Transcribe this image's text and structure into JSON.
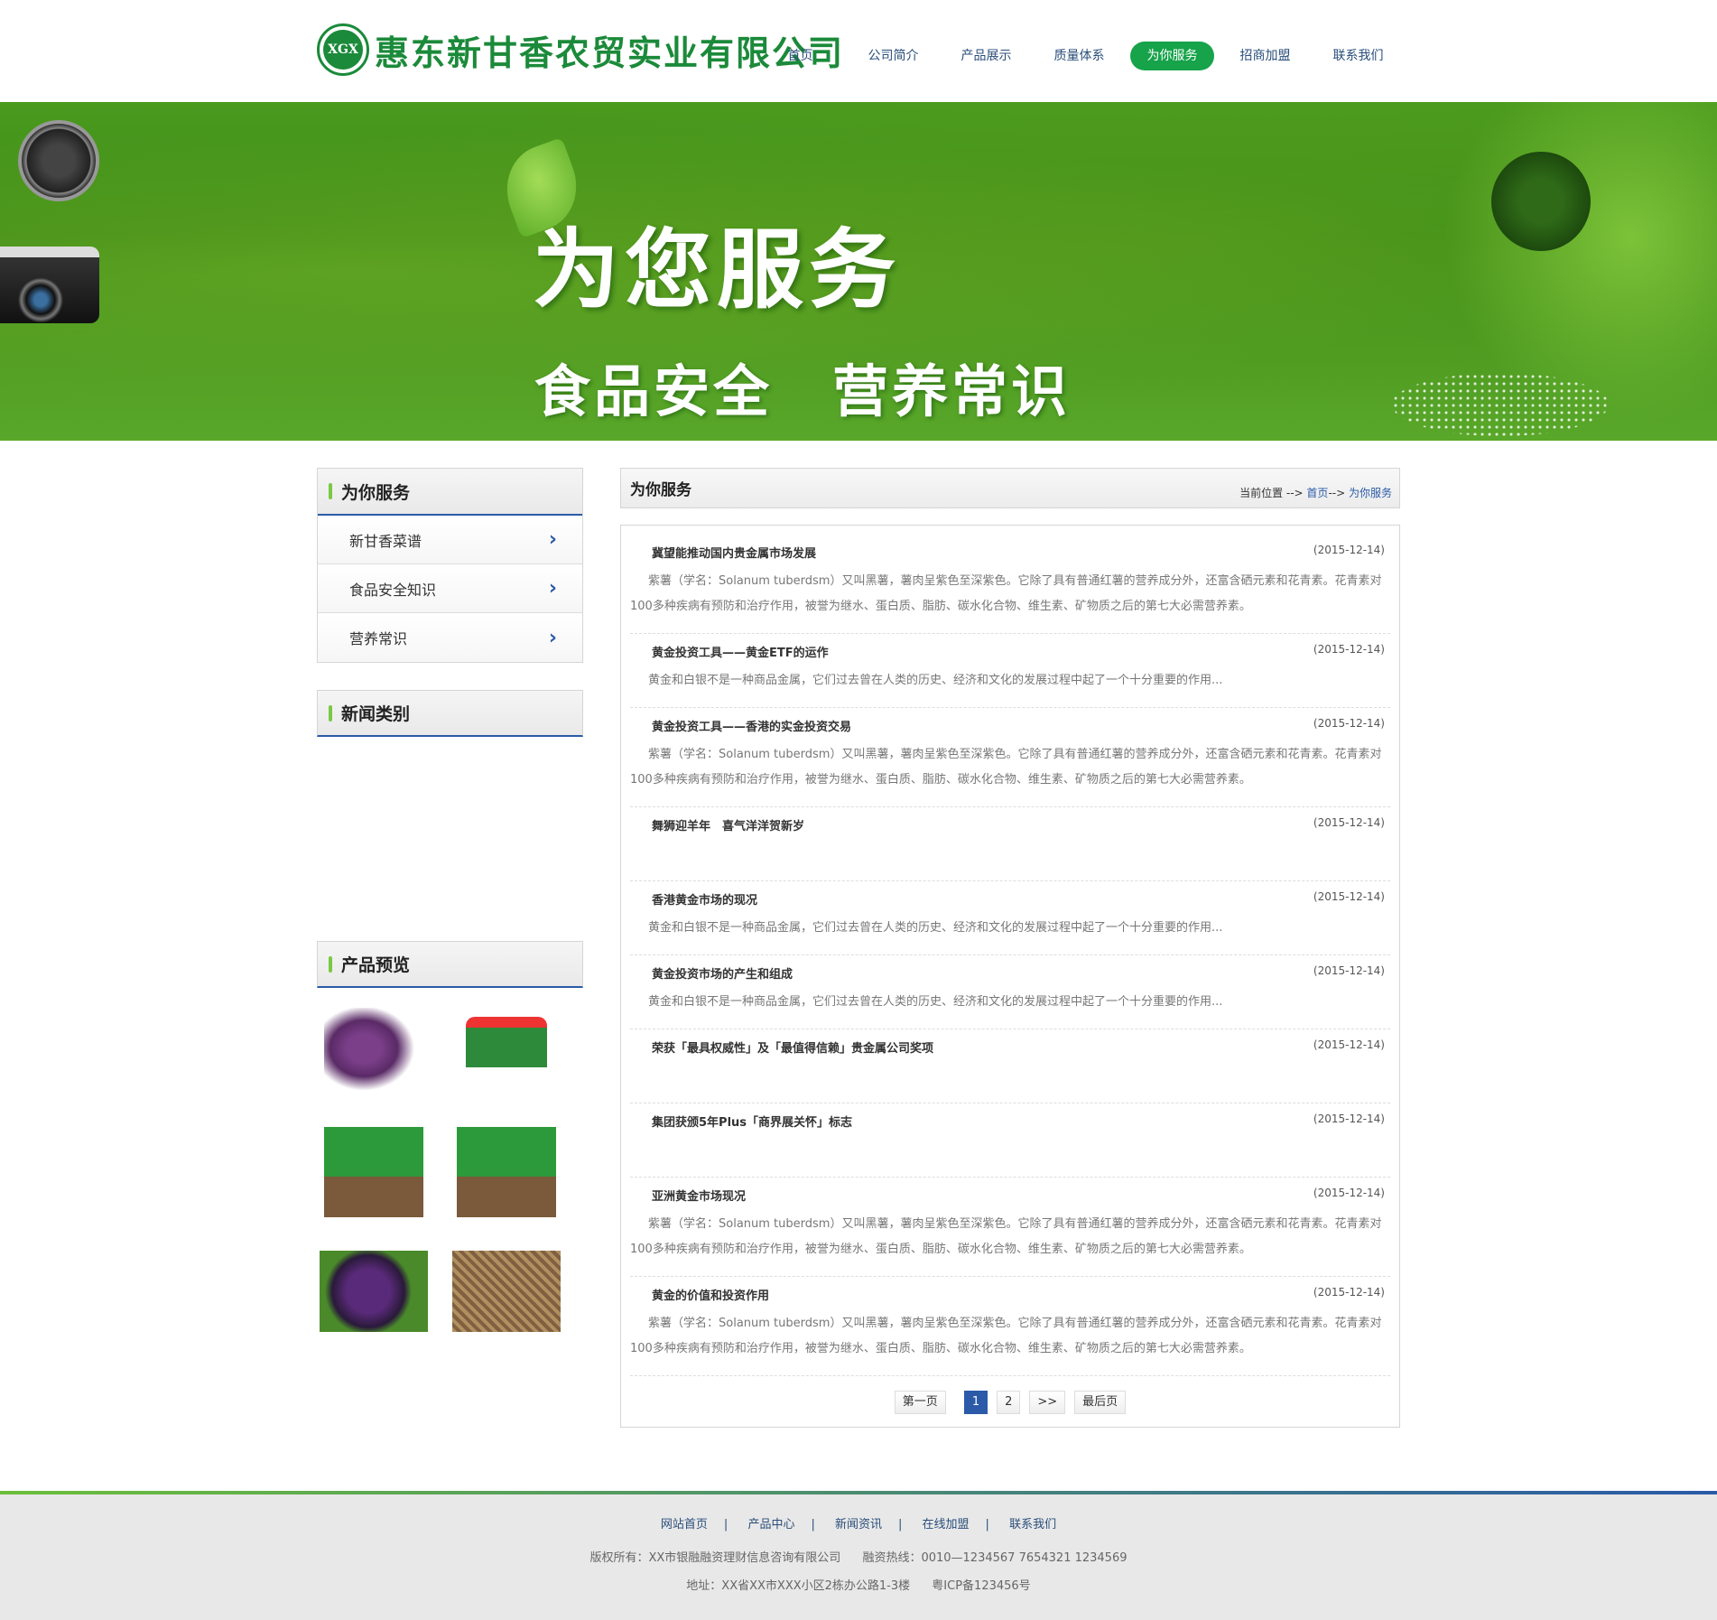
{
  "header": {
    "logo_emblem": "XGX",
    "logo_text": "惠东新甘香农贸实业有限公司",
    "nav": [
      {
        "label": "首页",
        "active": false
      },
      {
        "label": "公司简介",
        "active": false
      },
      {
        "label": "产品展示",
        "active": false
      },
      {
        "label": "质量体系",
        "active": false
      },
      {
        "label": "为你服务",
        "active": true
      },
      {
        "label": "招商加盟",
        "active": false
      },
      {
        "label": "联系我们",
        "active": false
      }
    ]
  },
  "banner": {
    "title": "为您服务",
    "subtitle": "食品安全　营养常识"
  },
  "sidebar": {
    "service": {
      "title": "为你服务",
      "items": [
        {
          "label": "新甘香菜谱"
        },
        {
          "label": "食品安全知识"
        },
        {
          "label": "营养常识"
        }
      ]
    },
    "news_categories": {
      "title": "新闻类别"
    },
    "products": {
      "title": "产品预览"
    }
  },
  "content": {
    "title": "为你服务",
    "breadcrumb": {
      "prefix": "当前位置 -->",
      "home": "首页",
      "arrow": "-->",
      "current": "为你服务"
    },
    "news": [
      {
        "title": "冀望能推动国内贵金属市场发展",
        "date": "(2015-12-14)",
        "desc": "紫薯（学名：Solanum tuberdsm）又叫黑薯，薯肉呈紫色至深紫色。它除了具有普通红薯的营养成分外，还富含硒元素和花青素。花青素对100多种疾病有预防和治疗作用，被誉为继水、蛋白质、脂肪、碳水化合物、维生素、矿物质之后的第七大必需营养素。"
      },
      {
        "title": "黄金投资工具——黄金ETF的运作",
        "date": "(2015-12-14)",
        "desc": "黄金和白银不是一种商品金属，它们过去曾在人类的历史、经济和文化的发展过程中起了一个十分重要的作用..."
      },
      {
        "title": "黄金投资工具——香港的实金投资交易",
        "date": "(2015-12-14)",
        "desc": "紫薯（学名：Solanum tuberdsm）又叫黑薯，薯肉呈紫色至深紫色。它除了具有普通红薯的营养成分外，还富含硒元素和花青素。花青素对100多种疾病有预防和治疗作用，被誉为继水、蛋白质、脂肪、碳水化合物、维生素、矿物质之后的第七大必需营养素。"
      },
      {
        "title": "舞狮迎羊年　喜气洋洋贺新岁",
        "date": "(2015-12-14)",
        "desc": ""
      },
      {
        "title": "香港黄金市场的现况",
        "date": "(2015-12-14)",
        "desc": "黄金和白银不是一种商品金属，它们过去曾在人类的历史、经济和文化的发展过程中起了一个十分重要的作用..."
      },
      {
        "title": "黄金投资市场的产生和组成",
        "date": "(2015-12-14)",
        "desc": "黄金和白银不是一种商品金属，它们过去曾在人类的历史、经济和文化的发展过程中起了一个十分重要的作用..."
      },
      {
        "title": "荣获「最具权威性」及「最值得信赖」贵金属公司奖项",
        "date": "(2015-12-14)",
        "desc": ""
      },
      {
        "title": "集团获颁5年Plus「商界展关怀」标志",
        "date": "(2015-12-14)",
        "desc": ""
      },
      {
        "title": "亚洲黄金市场现况",
        "date": "(2015-12-14)",
        "desc": "紫薯（学名：Solanum tuberdsm）又叫黑薯，薯肉呈紫色至深紫色。它除了具有普通红薯的营养成分外，还富含硒元素和花青素。花青素对100多种疾病有预防和治疗作用，被誉为继水、蛋白质、脂肪、碳水化合物、维生素、矿物质之后的第七大必需营养素。"
      },
      {
        "title": "黄金的价值和投资作用",
        "date": "(2015-12-14)",
        "desc": "紫薯（学名：Solanum tuberdsm）又叫黑薯，薯肉呈紫色至深紫色。它除了具有普通红薯的营养成分外，还富含硒元素和花青素。花青素对100多种疾病有预防和治疗作用，被誉为继水、蛋白质、脂肪、碳水化合物、维生素、矿物质之后的第七大必需营养素。"
      }
    ],
    "pager": {
      "first": "第一页",
      "pages": [
        "1",
        "2"
      ],
      "current": "1",
      "next": ">>",
      "last": "最后页"
    }
  },
  "footer": {
    "links": [
      "网站首页",
      "产品中心",
      "新闻资讯",
      "在线加盟",
      "联系我们"
    ],
    "separator": "|",
    "copyright": "版权所有：XX市银融融资理财信息咨询有限公司",
    "hotline": "融资热线：0010—1234567 7654321 1234569",
    "address": "地址：XX省XX市XXX小区2栋办公路1-3楼",
    "icp": "粤ICP备123456号"
  },
  "colors": {
    "brand_green": "#1b8a3a",
    "nav_active": "#16a34a",
    "accent_blue": "#2a5aa8"
  }
}
